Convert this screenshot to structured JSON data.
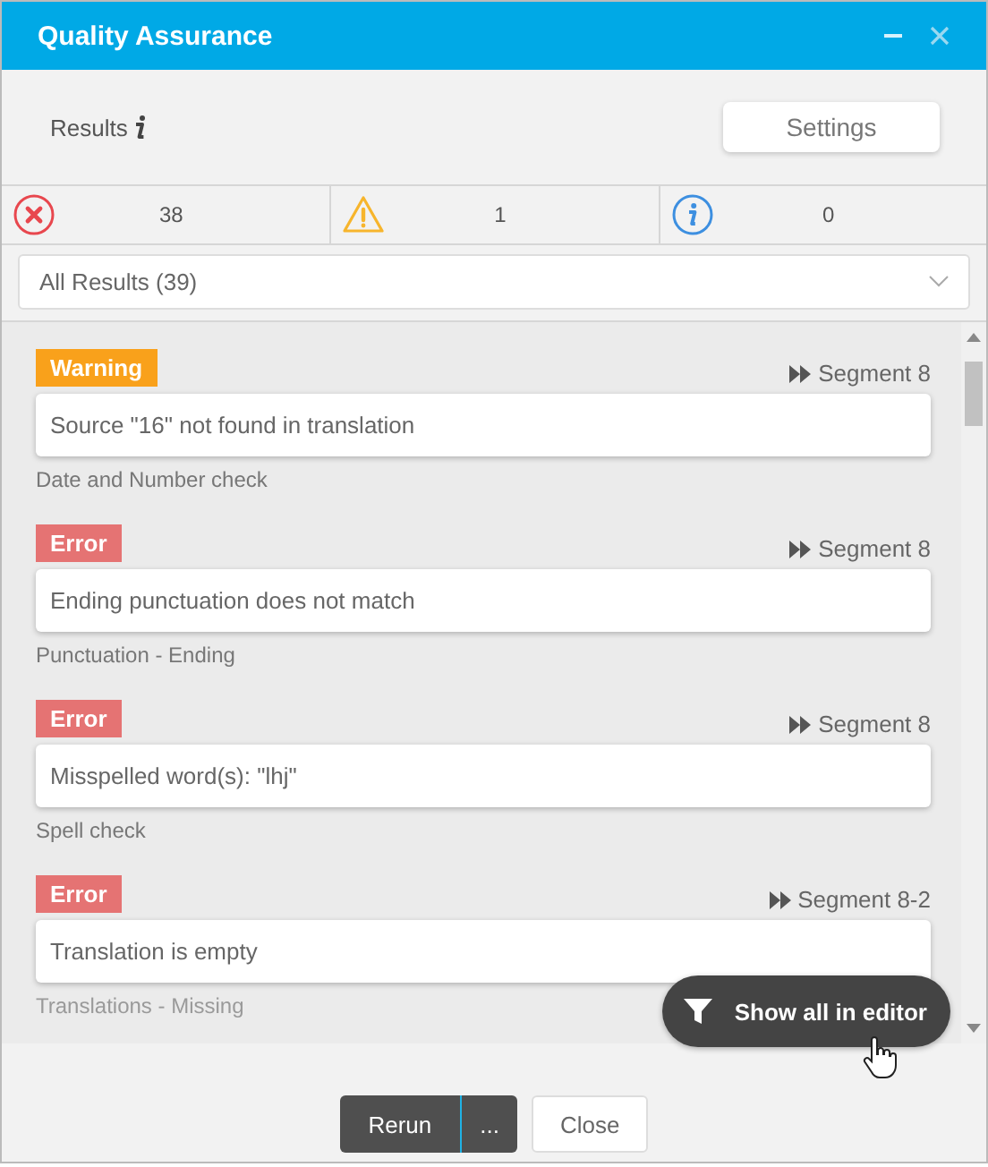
{
  "window": {
    "title": "Quality Assurance"
  },
  "header": {
    "label": "Results",
    "settings_button": "Settings"
  },
  "counts": [
    {
      "kind": "error",
      "count": "38"
    },
    {
      "kind": "warning",
      "count": "1"
    },
    {
      "kind": "info",
      "count": "0"
    }
  ],
  "filter": {
    "value": "All Results (39)"
  },
  "results": [
    {
      "kind": "warning",
      "badge": "Warning",
      "segment": "Segment 8",
      "message": "Source \"16\" not found in translation",
      "check": "Date and Number check"
    },
    {
      "kind": "error",
      "badge": "Error",
      "segment": "Segment 8",
      "message": "Ending punctuation does not match",
      "check": "Punctuation - Ending"
    },
    {
      "kind": "error",
      "badge": "Error",
      "segment": "Segment 8",
      "message": "Misspelled word(s): \"lhj\"",
      "check": "Spell check"
    },
    {
      "kind": "error",
      "badge": "Error",
      "segment": "Segment 8-2",
      "message": "Translation is empty",
      "check": "Translations - Missing"
    }
  ],
  "floating_button": "Show all in editor",
  "footer": {
    "rerun": "Rerun",
    "more": "...",
    "close": "Close"
  }
}
